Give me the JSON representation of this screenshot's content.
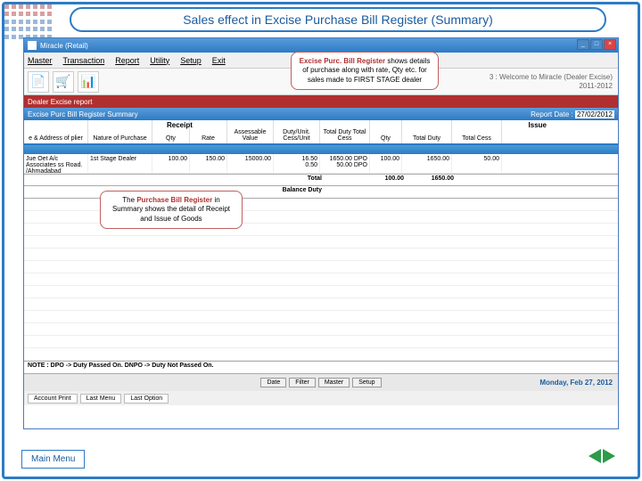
{
  "slide_title": "Sales effect in Excise Purchase Bill Register (Summary)",
  "window": {
    "title": "Miracle (Retail)",
    "subtitle_right_1": "3 : Welcome to Miracle (Dealer Excise)",
    "subtitle_right_2": "2011-2012"
  },
  "menu": [
    "Master",
    "Transaction",
    "Report",
    "Utility",
    "Setup",
    "Exit"
  ],
  "red_strip": "Dealer Excise report",
  "sub_window_title": "Excise Purc Bill Register Summary",
  "report_date_label": "Report Date :",
  "report_date_value": "27/02/2012",
  "sections": {
    "receipt": "Receipt",
    "issue": "Issue"
  },
  "headers": {
    "name_addr": "e & Address of plier",
    "nature": "Nature of Purchase",
    "qty": "Qty",
    "rate": "Rate",
    "assess": "Assessable Value",
    "duty_unit": "Duty/Unit. Cess/Unit",
    "total_duty": "Total Duty Total Cess",
    "issue_qty": "Qty",
    "issue_total_duty": "Total Duty",
    "issue_total_cess": "Total Cess"
  },
  "row": {
    "supplier": "Jue Oet A/c Associates ss Road. /Ahmadabad",
    "nature": "1st Stage Dealer",
    "qty": "100.00",
    "rate": "150.00",
    "assess": "15000.00",
    "duty_unit_1": "16.50",
    "duty_unit_2": "0.50",
    "total_duty_1": "1650.00",
    "total_duty_2": "50.00",
    "dpo": "DPO",
    "issue_qty": "100.00",
    "issue_duty": "1650.00",
    "issue_cess": "50.00"
  },
  "totals": {
    "label_total": "Total",
    "t_qty": "100.00",
    "t_duty": "1650.00",
    "label_balance": "Balance Duty"
  },
  "note": "NOTE : DPO -> Duty Passed On.   DNPO -> Duty Not Passed On.",
  "buttons_center": [
    "Date",
    "Filter",
    "Master",
    "Setup"
  ],
  "buttons_bottom": [
    "Account Print",
    "Last Menu",
    "Last Option"
  ],
  "date_long": "Monday, Feb 27, 2012",
  "callout1_a": "Excise Purc. Bill Register",
  "callout1_b": " shows details of purchase along with rate, Qty etc. for sales made to FIRST STAGE dealer",
  "callout2_a": "The ",
  "callout2_b": "Purchase Bill Register",
  "callout2_c": " in Summary shows the detail of Receipt and Issue of Goods",
  "main_menu": "Main Menu"
}
